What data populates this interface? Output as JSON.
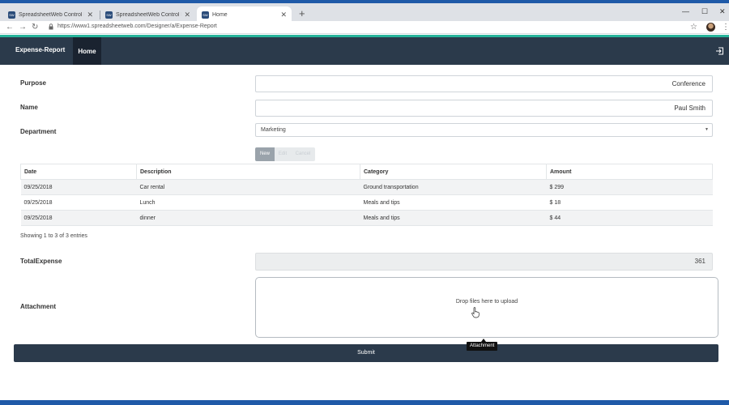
{
  "browser": {
    "tabs": [
      {
        "title": "SpreadsheetWeb Control Panel"
      },
      {
        "title": "SpreadsheetWeb Control Panel"
      },
      {
        "title": "Home"
      }
    ],
    "favicon_text": "SW",
    "url": "https://www1.spreadsheetweb.com/Designer/a/Expense-Report",
    "icons": {
      "back": "arrow-left-icon",
      "forward": "arrow-right-icon",
      "reload": "reload-icon",
      "lock": "lock-icon",
      "star": "star-icon",
      "profile": "avatar",
      "menu": "kebab-menu-icon"
    }
  },
  "navbar": {
    "brand": "Expense-Report",
    "home": "Home",
    "logout_icon": "logout-icon"
  },
  "form": {
    "purpose": {
      "label": "Purpose",
      "value": "Conference"
    },
    "name": {
      "label": "Name",
      "value": "Paul Smith"
    },
    "department": {
      "label": "Department",
      "value": "Marketing"
    },
    "buttons": {
      "new": "New",
      "edit": "Edit",
      "cancel": "Cancel"
    },
    "table": {
      "headers": {
        "date": "Date",
        "description": "Description",
        "category": "Category",
        "amount": "Amount"
      },
      "rows": [
        {
          "date": "09/25/2018",
          "description": "Car rental",
          "category": "Ground transportation",
          "amount": "$ 299"
        },
        {
          "date": "09/25/2018",
          "description": "Lunch",
          "category": "Meals and tips",
          "amount": "$ 18"
        },
        {
          "date": "09/25/2018",
          "description": "dinner",
          "category": "Meals and tips",
          "amount": "$ 44"
        }
      ],
      "info": "Showing 1 to 3 of 3 entries"
    },
    "total": {
      "label": "TotalExpense",
      "value": "361"
    },
    "attachment": {
      "label": "Attachment",
      "dropzone_text": "Drop files here to upload",
      "tooltip": "Attachment"
    },
    "submit": "Submit"
  },
  "colors": {
    "navbar": "#2b3a4b",
    "accent_teal": "#26b39a",
    "taskbar_blue": "#1f5aa8"
  }
}
